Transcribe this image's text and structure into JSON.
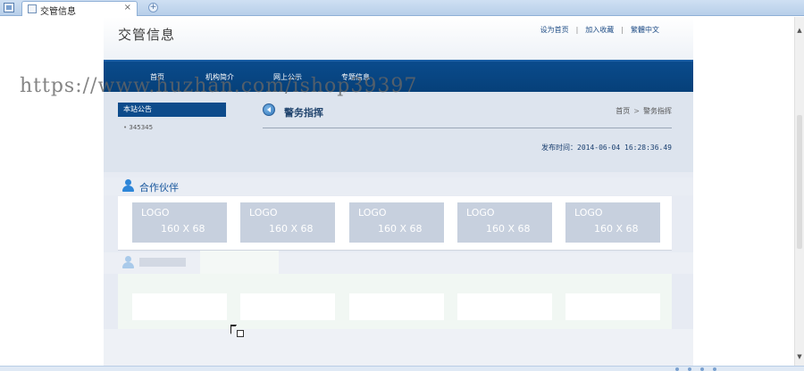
{
  "browser": {
    "tab_title": "交管信息",
    "tab_close": "×",
    "new_tab": "+"
  },
  "header": {
    "site_title": "交管信息",
    "links": [
      "设为首页",
      "加入收藏",
      "繁體中文"
    ],
    "separator": "|"
  },
  "nav": {
    "items": [
      "首页",
      "机构简介",
      "网上公示",
      "专题信息"
    ]
  },
  "sidebar": {
    "notice_title": "本站公告",
    "notice_items": [
      "345345"
    ]
  },
  "article": {
    "section_title": "警务指挥",
    "breadcrumb": [
      "首页",
      "警务指挥"
    ],
    "breadcrumb_arrow": ">",
    "publish_time": "发布时间：2014-06-04 16:28:36.49"
  },
  "partners": {
    "title": "合作伙伴",
    "logos": [
      {
        "line1": "LOGO",
        "line2": "160 X 68"
      },
      {
        "line1": "LOGO",
        "line2": "160 X 68"
      },
      {
        "line1": "LOGO",
        "line2": "160 X 68"
      },
      {
        "line1": "LOGO",
        "line2": "160 X 68"
      },
      {
        "line1": "LOGO",
        "line2": "160 X 68"
      }
    ]
  },
  "watermark": "https://www.huzhan.com/ishop39397",
  "colors": {
    "nav_bg": "#0a4b8c",
    "accent_blue": "#15559c",
    "logo_box": "#c7d0de"
  }
}
